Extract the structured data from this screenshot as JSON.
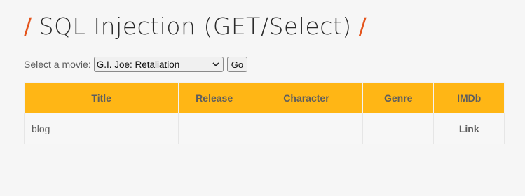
{
  "header": {
    "title": "SQL Injection (GET/Select)",
    "slash": "/"
  },
  "form": {
    "label": "Select a movie:",
    "selected_movie": "G.I. Joe: Retaliation",
    "go_label": "Go"
  },
  "table": {
    "columns": [
      "Title",
      "Release",
      "Character",
      "Genre",
      "IMDb"
    ],
    "rows": [
      {
        "title": "blog",
        "release": "",
        "character": "",
        "genre": "",
        "imdb": "Link"
      }
    ]
  },
  "colors": {
    "accent": "#e4541c",
    "table_header": "#ffb615"
  }
}
